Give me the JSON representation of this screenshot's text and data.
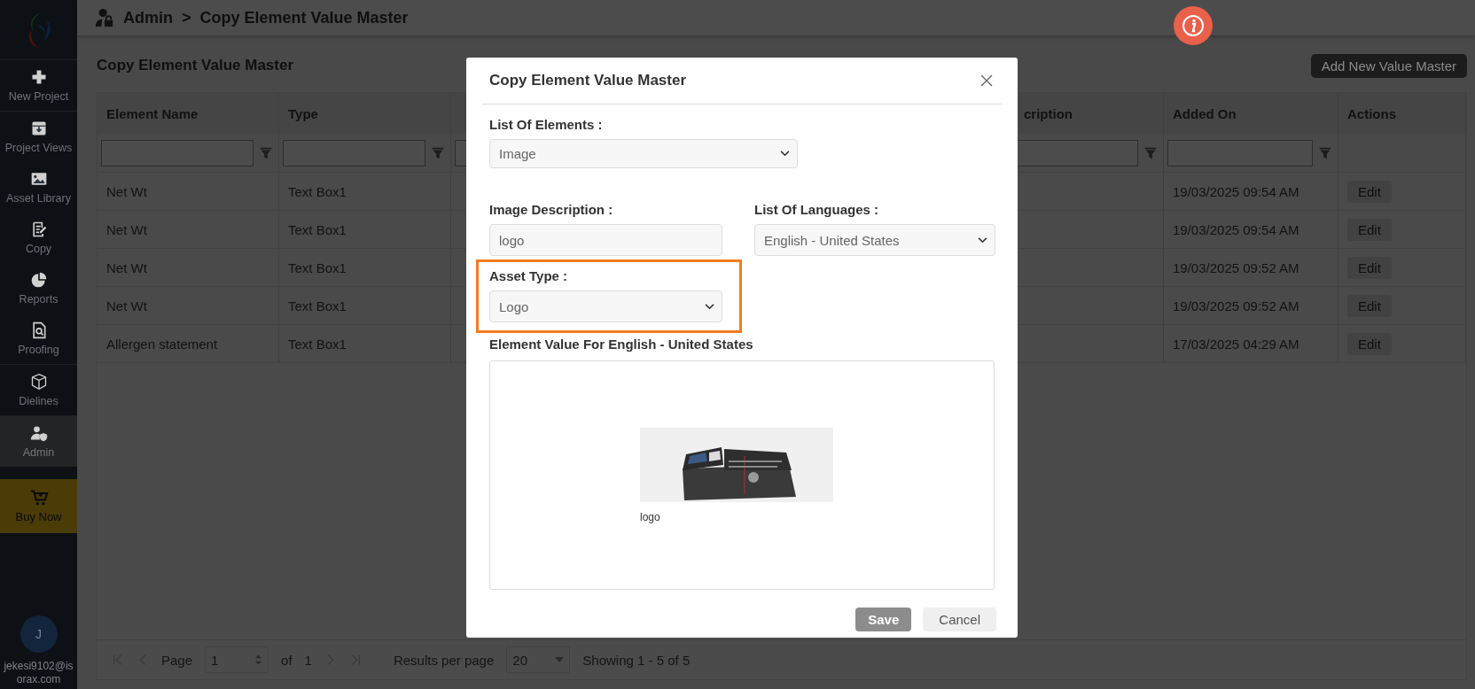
{
  "sidebar": {
    "items": [
      {
        "label": "New Project",
        "selected": false,
        "divider_after": true
      },
      {
        "label": "Project Views",
        "selected": false,
        "divider_after": false
      },
      {
        "label": "Asset Library",
        "selected": false,
        "divider_after": false
      },
      {
        "label": "Copy",
        "selected": false,
        "divider_after": false
      },
      {
        "label": "Reports",
        "selected": false,
        "divider_after": false
      },
      {
        "label": "Proofing",
        "selected": false,
        "divider_after": true
      },
      {
        "label": "Dielines",
        "selected": false,
        "divider_after": true
      },
      {
        "label": "Admin",
        "selected": true,
        "divider_after": false
      }
    ],
    "buy_now": "Buy Now",
    "user": {
      "initial": "J",
      "email": "jekesi9102@isorax.com"
    }
  },
  "breadcrumb": {
    "items": [
      "Admin",
      "Copy Element Value Master"
    ],
    "separator": ">"
  },
  "page": {
    "title": "Copy Element Value Master",
    "add_button": "Add New Value Master"
  },
  "table": {
    "columns": [
      {
        "label": "Element Name",
        "filter": true
      },
      {
        "label": "Type",
        "filter": true
      },
      {
        "label": "cription",
        "filter": true
      },
      {
        "label": "Added On",
        "filter": true
      },
      {
        "label": "Actions",
        "filter": false
      }
    ],
    "rows": [
      {
        "element_name": "Net Wt",
        "type": "Text Box1",
        "added_on": "19/03/2025 09:54 AM",
        "action": "Edit"
      },
      {
        "element_name": "Net Wt",
        "type": "Text Box1",
        "added_on": "19/03/2025 09:54 AM",
        "action": "Edit"
      },
      {
        "element_name": "Net Wt",
        "type": "Text Box1",
        "added_on": "19/03/2025 09:52 AM",
        "action": "Edit"
      },
      {
        "element_name": "Net Wt",
        "type": "Text Box1",
        "added_on": "19/03/2025 09:52 AM",
        "action": "Edit"
      },
      {
        "element_name": "Allergen statement",
        "type": "Text Box1",
        "added_on": "17/03/2025 04:29 AM",
        "action": "Edit"
      }
    ]
  },
  "pagination": {
    "page_label": "Page",
    "page": "1",
    "of_label": "of",
    "total_pages": "1",
    "results_label": "Results per page",
    "per_page": "20",
    "summary": "Showing 1 - 5 of 5"
  },
  "modal": {
    "title": "Copy Element Value Master",
    "fields": [
      {
        "kind": "select",
        "label": "List Of Elements :",
        "value": "Image",
        "highlighted": false
      },
      {
        "kind": "input",
        "label": "Image Description :",
        "value": "logo",
        "highlighted": false
      },
      {
        "kind": "select",
        "label": "List Of Languages :",
        "value": "English - United States",
        "highlighted": false
      },
      {
        "kind": "select",
        "label": "Asset Type :",
        "value": "Logo",
        "highlighted": true
      }
    ],
    "value_label": "Element Value For English - United States",
    "asset": {
      "kind": "picture",
      "caption": "logo"
    },
    "buttons": [
      {
        "label": "Save",
        "kind": "primary"
      },
      {
        "label": "Cancel",
        "kind": "secondary"
      }
    ]
  }
}
